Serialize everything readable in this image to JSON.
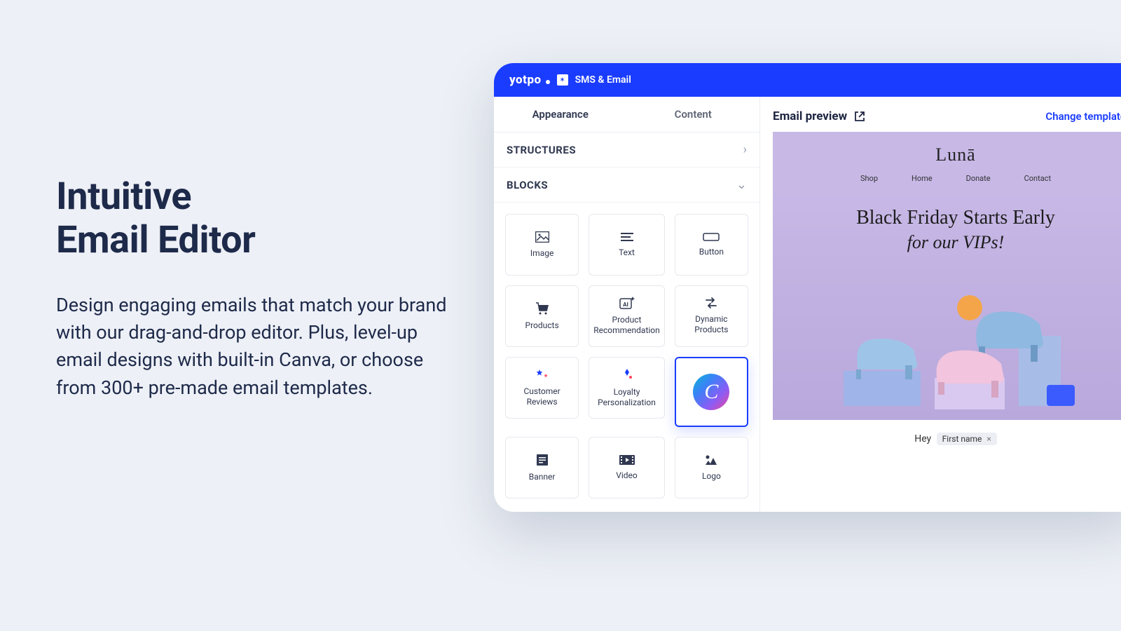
{
  "hero": {
    "title_line1": "Intuitive",
    "title_line2": "Email Editor",
    "body": "Design engaging emails that match your brand with our drag-and-drop editor. Plus, level-up email designs with built-in Canva, or choose from 300+ pre-made email templates."
  },
  "app": {
    "brand": "yotpo",
    "brand_sub": "SMS & Email",
    "tabs": {
      "appearance": "Appearance",
      "content": "Content"
    },
    "sections": {
      "structures": "STRUCTURES",
      "blocks": "BLOCKS"
    },
    "blocks": {
      "image": "Image",
      "text": "Text",
      "button": "Button",
      "products": "Products",
      "recommendation": "Product Recommendation",
      "dynamic": "Dynamic Products",
      "reviews": "Customer Reviews",
      "loyalty": "Loyalty Personalization",
      "banner": "Banner",
      "video": "Video",
      "logo": "Logo"
    }
  },
  "preview": {
    "title": "Email preview",
    "change_link": "Change template",
    "template": {
      "brand": "Lunā",
      "nav": {
        "shop": "Shop",
        "home": "Home",
        "donate": "Donate",
        "contact": "Contact"
      },
      "headline1": "Black Friday Starts Early",
      "headline2": "for our VIPs!",
      "greet": "Hey",
      "token": "First name"
    }
  }
}
